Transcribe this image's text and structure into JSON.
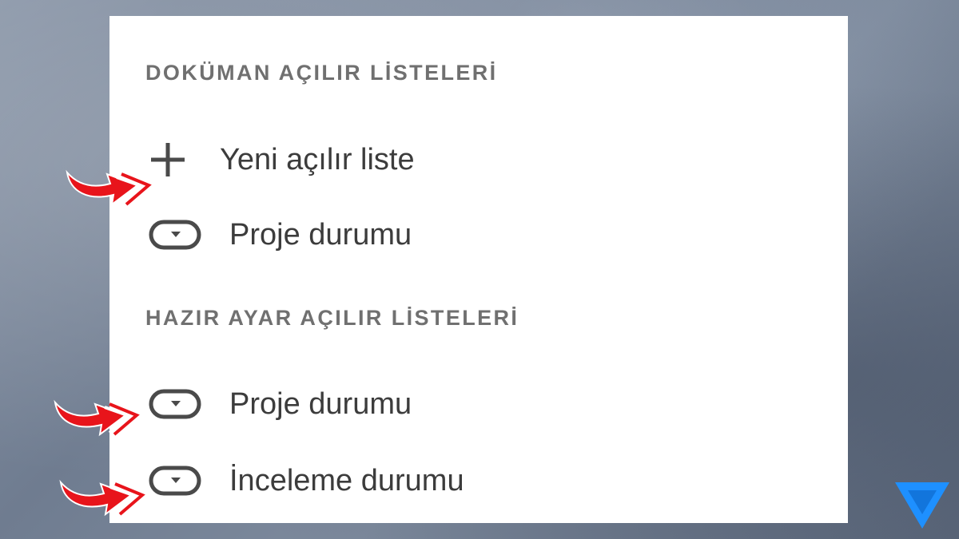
{
  "doc_section": {
    "header": "DOKÜMAN AÇILIR LİSTELERİ",
    "new_item": {
      "label": "Yeni açılır liste",
      "icon": "plus-icon"
    },
    "items": [
      {
        "label": "Proje durumu",
        "icon": "dropdown-chip-icon"
      }
    ]
  },
  "preset_section": {
    "header": "HAZIR AYAR AÇILIR LİSTELERİ",
    "items": [
      {
        "label": "Proje durumu",
        "icon": "dropdown-chip-icon"
      },
      {
        "label": "İnceleme durumu",
        "icon": "dropdown-chip-icon"
      }
    ]
  },
  "annotations": {
    "arrow_color": "#e8141b",
    "arrow_count": 3
  },
  "colors": {
    "header_text": "#707070",
    "item_text": "#3c3c3c",
    "icon": "#4a4a4a",
    "logo": "#1e90ff"
  }
}
